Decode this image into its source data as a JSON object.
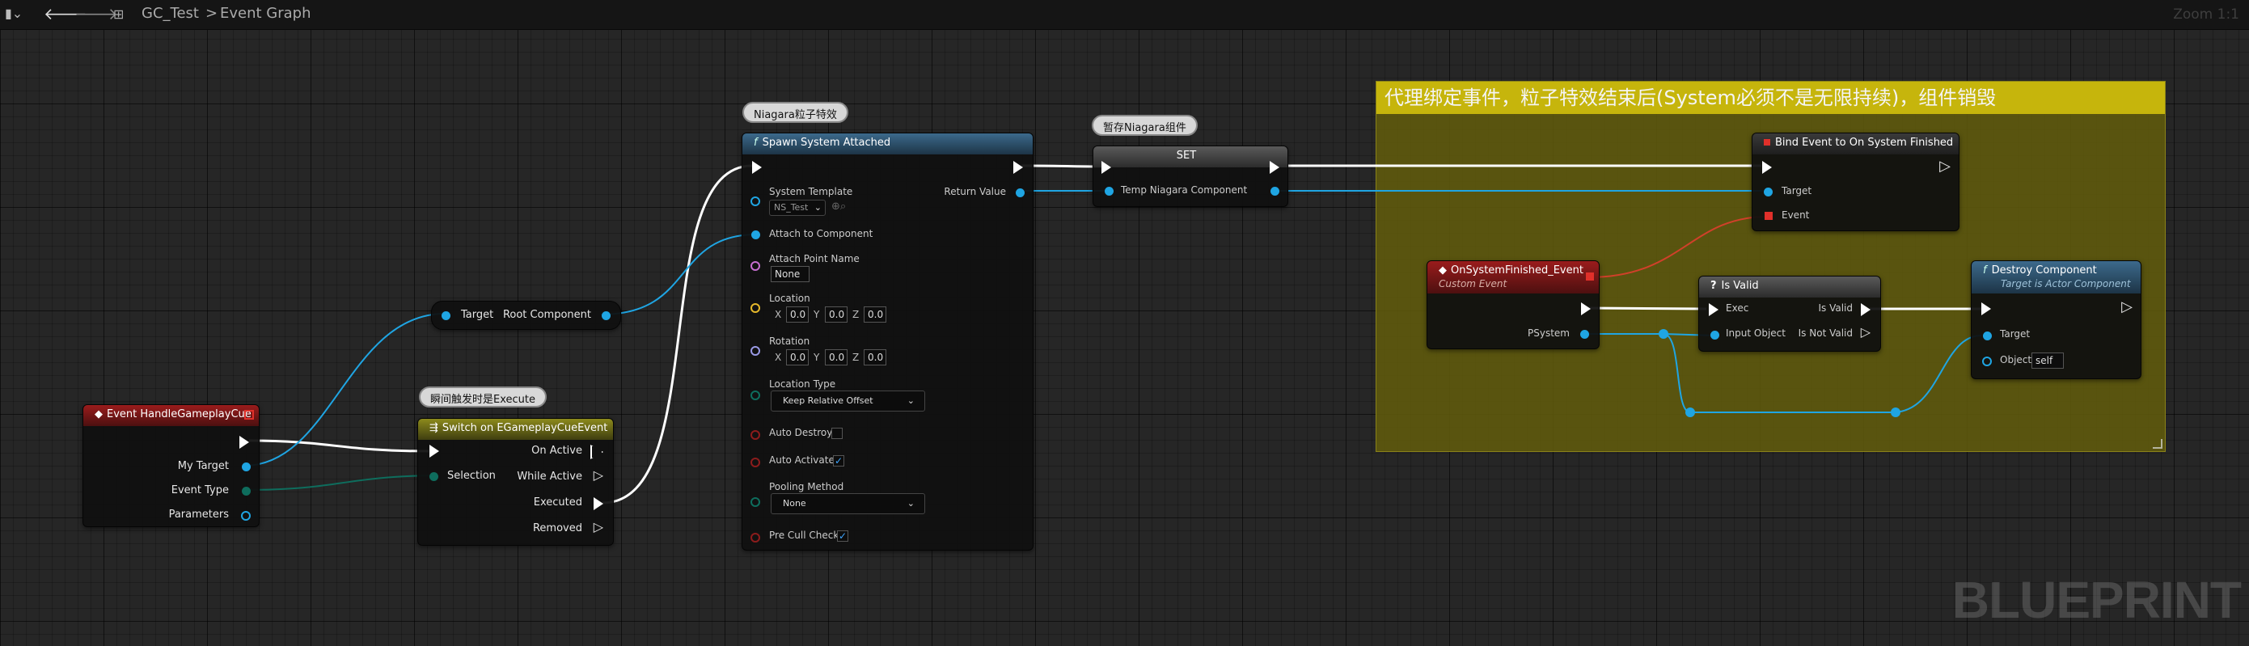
{
  "toolbar": {
    "breadcrumb_graph": "GC_Test",
    "breadcrumb_separator": ">",
    "breadcrumb_page": "Event Graph",
    "zoom": "Zoom 1:1"
  },
  "watermark": "BLUEPRINT",
  "comment": {
    "title": "代理绑定事件，粒子特效结束后(System必须不是无限持续)，组件销毁"
  },
  "nodes": {
    "event_handle": {
      "title": "Event HandleGameplayCue",
      "pins": {
        "my_target": "My Target",
        "event_type": "Event Type",
        "parameters": "Parameters"
      }
    },
    "switch": {
      "bubble": "瞬间触发时是Execute",
      "title": "Switch on EGameplayCueEvent",
      "pins": {
        "selection": "Selection",
        "on_active": "On Active",
        "while_active": "While Active",
        "executed": "Executed",
        "removed": "Removed"
      }
    },
    "get_root": {
      "pins": {
        "target": "Target",
        "root_component": "Root Component"
      }
    },
    "spawn": {
      "bubble": "Niagara粒子特效",
      "title": "Spawn System Attached",
      "pins": {
        "system_template": "System Template",
        "system_template_value": "NS_Test",
        "return_value": "Return Value",
        "attach_to_component": "Attach to Component",
        "attach_point_name": "Attach Point Name",
        "attach_point_value": "None",
        "location": "Location",
        "rotation": "Rotation",
        "location_type": "Location Type",
        "location_type_value": "Keep Relative Offset",
        "auto_destroy": "Auto Destroy",
        "auto_activate": "Auto Activate",
        "pooling_method": "Pooling Method",
        "pooling_method_value": "None",
        "pre_cull_check": "Pre Cull Check"
      },
      "vec": {
        "x": "X",
        "y": "Y",
        "z": "Z",
        "value": "0.0"
      },
      "auto_destroy_checked": false,
      "auto_activate_checked": true,
      "pre_cull_check_checked": true
    },
    "set": {
      "bubble": "暂存Niagara组件",
      "title": "SET",
      "pins": {
        "temp_niagara": "Temp Niagara Component"
      }
    },
    "bind_event": {
      "title": "Bind Event to On System Finished",
      "pins": {
        "target": "Target",
        "event": "Event"
      }
    },
    "custom_event": {
      "title": "OnSystemFinished_Event",
      "subtitle": "Custom Event",
      "pins": {
        "psystem": "PSystem"
      }
    },
    "is_valid": {
      "title": "Is Valid",
      "pins": {
        "exec": "Exec",
        "input_object": "Input Object",
        "is_valid": "Is Valid",
        "is_not_valid": "Is Not Valid"
      }
    },
    "destroy": {
      "title": "Destroy Component",
      "subtitle": "Target is Actor Component",
      "pins": {
        "target": "Target",
        "object": "Object",
        "object_value": "self"
      }
    }
  },
  "colors": {
    "exec_wire": "#ffffff",
    "object_wire": "#1fa5e3",
    "enum_wire": "#0e6d5d",
    "delegate_wire": "#d0402a",
    "comment_header": "#c6b50c",
    "comment_body": "#625c0c"
  }
}
